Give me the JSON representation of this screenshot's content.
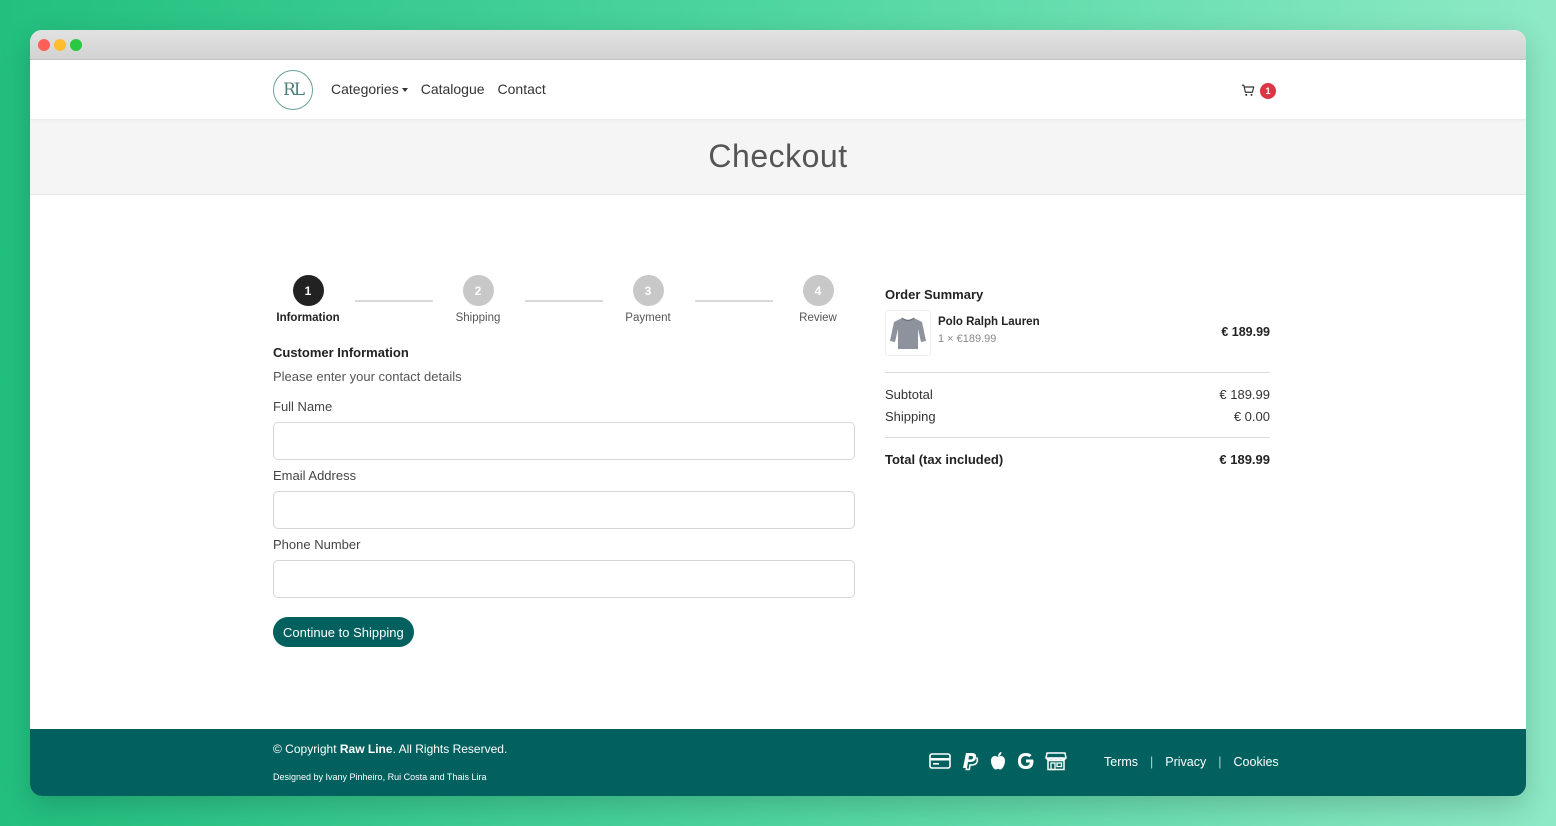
{
  "brand": {
    "logo_text": "RL",
    "accent": "#02605f",
    "badge": "#dc3545"
  },
  "nav": {
    "categories": "Categories",
    "catalogue": "Catalogue",
    "contact": "Contact",
    "cart_count": "1"
  },
  "page": {
    "title": "Checkout"
  },
  "steps": [
    {
      "number": "1",
      "label": "Information",
      "active": true
    },
    {
      "number": "2",
      "label": "Shipping",
      "active": false
    },
    {
      "number": "3",
      "label": "Payment",
      "active": false
    },
    {
      "number": "4",
      "label": "Review",
      "active": false
    }
  ],
  "form": {
    "title": "Customer Information",
    "subtitle": "Please enter your contact details",
    "full_name_label": "Full Name",
    "full_name_value": "",
    "email_label": "Email Address",
    "email_value": "",
    "phone_label": "Phone Number",
    "phone_value": "",
    "submit_label": "Continue to Shipping"
  },
  "summary": {
    "title": "Order Summary",
    "item": {
      "name": "Polo Ralph Lauren",
      "qty_price": "1 × €189.99",
      "line_total": "€ 189.99"
    },
    "subtotal_label": "Subtotal",
    "subtotal_value": "€ 189.99",
    "shipping_label": "Shipping",
    "shipping_value": "€ 0.00",
    "total_label": "Total (tax included)",
    "total_value": "€ 189.99"
  },
  "footer": {
    "copyright_prefix": "© Copyright ",
    "copyright_brand": "Raw Line",
    "copyright_suffix": ". All Rights Reserved.",
    "designed_by": "Designed by Ivany Pinheiro, Rui Costa and Thais Lira",
    "payment_icons": [
      "credit-card-icon",
      "paypal-icon",
      "apple-icon",
      "google-icon",
      "store-icon"
    ],
    "links": {
      "terms": "Terms",
      "privacy": "Privacy",
      "cookies": "Cookies"
    }
  }
}
